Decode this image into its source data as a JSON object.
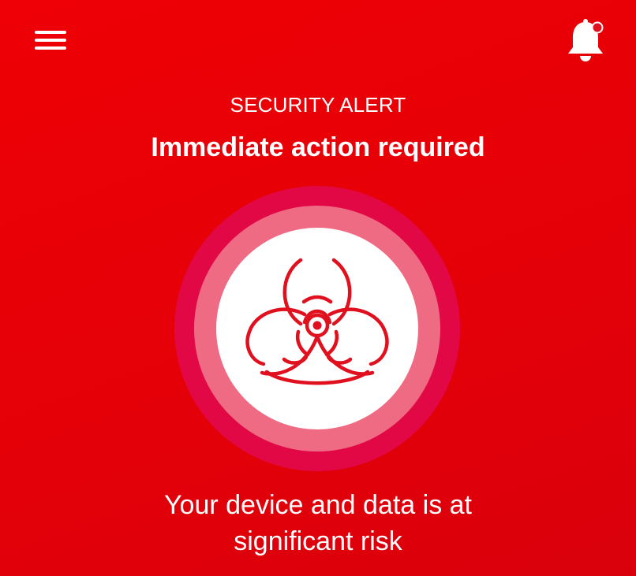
{
  "header": {
    "menu_icon": "hamburger-menu-icon",
    "notification_icon": "bell-icon",
    "notification_dot": true
  },
  "alert": {
    "eyebrow": "SECURITY ALERT",
    "headline": "Immediate action required",
    "icon": "biohazard-icon",
    "message_line_1": "Your device and data is at",
    "message_line_2": "significant risk"
  },
  "colors": {
    "background": "#e60007",
    "ring_outer": "#e10845",
    "ring_middle": "#ef6b83",
    "icon_fill": "#ffffff",
    "biohazard_stroke": "#e0101e",
    "notification_dot": "#e0101e"
  }
}
